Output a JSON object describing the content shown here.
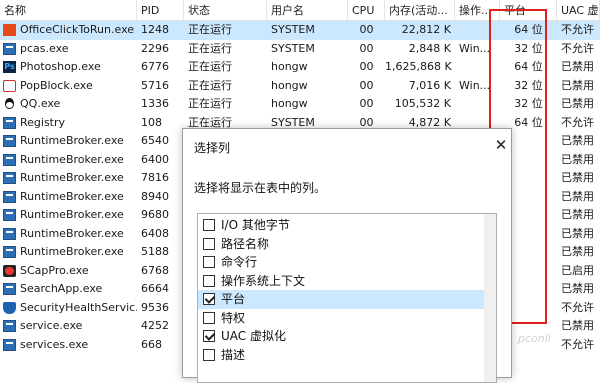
{
  "columns": [
    "名称",
    "PID",
    "状态",
    "用户名",
    "CPU",
    "内存(活动...",
    "操作...",
    "平台",
    "UAC 虚拟化"
  ],
  "rows": [
    {
      "name": "OfficeClickToRun.exe",
      "pid": "1248",
      "status": "正在运行",
      "user": "SYSTEM",
      "cpu": "00",
      "mem": "22,812 K",
      "op": "",
      "platform": "64 位",
      "uac": "不允许",
      "icon": "office-icon",
      "selected": true
    },
    {
      "name": "pcas.exe",
      "pid": "2296",
      "status": "正在运行",
      "user": "SYSTEM",
      "cpu": "00",
      "mem": "2,848 K",
      "op": "Win...",
      "platform": "32 位",
      "uac": "不允许",
      "icon": "app-icon",
      "selected": false
    },
    {
      "name": "Photoshop.exe",
      "pid": "6776",
      "status": "正在运行",
      "user": "hongw",
      "cpu": "00",
      "mem": "1,625,868 K",
      "op": "",
      "platform": "64 位",
      "uac": "已禁用",
      "icon": "photoshop-icon",
      "selected": false
    },
    {
      "name": "PopBlock.exe",
      "pid": "5716",
      "status": "正在运行",
      "user": "hongw",
      "cpu": "00",
      "mem": "7,016 K",
      "op": "Win...",
      "platform": "32 位",
      "uac": "已禁用",
      "icon": "popblock-icon",
      "selected": false
    },
    {
      "name": "QQ.exe",
      "pid": "1336",
      "status": "正在运行",
      "user": "hongw",
      "cpu": "00",
      "mem": "105,532 K",
      "op": "",
      "platform": "32 位",
      "uac": "已禁用",
      "icon": "qq-icon",
      "selected": false
    },
    {
      "name": "Registry",
      "pid": "108",
      "status": "正在运行",
      "user": "SYSTEM",
      "cpu": "00",
      "mem": "4,872 K",
      "op": "",
      "platform": "64 位",
      "uac": "不允许",
      "icon": "app-icon",
      "selected": false
    },
    {
      "name": "RuntimeBroker.exe",
      "pid": "6540",
      "status": "",
      "user": "",
      "cpu": "",
      "mem": "",
      "op": "",
      "platform": "",
      "uac": "已禁用",
      "icon": "app-icon",
      "selected": false
    },
    {
      "name": "RuntimeBroker.exe",
      "pid": "6400",
      "status": "",
      "user": "",
      "cpu": "",
      "mem": "",
      "op": "",
      "platform": "",
      "uac": "已禁用",
      "icon": "app-icon",
      "selected": false
    },
    {
      "name": "RuntimeBroker.exe",
      "pid": "7816",
      "status": "",
      "user": "",
      "cpu": "",
      "mem": "",
      "op": "",
      "platform": "",
      "uac": "已禁用",
      "icon": "app-icon",
      "selected": false
    },
    {
      "name": "RuntimeBroker.exe",
      "pid": "8940",
      "status": "",
      "user": "",
      "cpu": "",
      "mem": "",
      "op": "",
      "platform": "",
      "uac": "已禁用",
      "icon": "app-icon",
      "selected": false
    },
    {
      "name": "RuntimeBroker.exe",
      "pid": "9680",
      "status": "",
      "user": "",
      "cpu": "",
      "mem": "",
      "op": "",
      "platform": "",
      "uac": "已禁用",
      "icon": "app-icon",
      "selected": false
    },
    {
      "name": "RuntimeBroker.exe",
      "pid": "6408",
      "status": "",
      "user": "",
      "cpu": "",
      "mem": "",
      "op": "",
      "platform": "",
      "uac": "已禁用",
      "icon": "app-icon",
      "selected": false
    },
    {
      "name": "RuntimeBroker.exe",
      "pid": "5188",
      "status": "",
      "user": "",
      "cpu": "",
      "mem": "",
      "op": "",
      "platform": "",
      "uac": "已禁用",
      "icon": "app-icon",
      "selected": false
    },
    {
      "name": "SCapPro.exe",
      "pid": "6768",
      "status": "",
      "user": "",
      "cpu": "",
      "mem": "",
      "op": "",
      "platform": "",
      "uac": "已启用",
      "icon": "scappro-icon",
      "selected": false
    },
    {
      "name": "SearchApp.exe",
      "pid": "6664",
      "status": "",
      "user": "",
      "cpu": "",
      "mem": "",
      "op": "",
      "platform": "",
      "uac": "已禁用",
      "icon": "app-icon",
      "selected": false
    },
    {
      "name": "SecurityHealthServic...",
      "pid": "9536",
      "status": "",
      "user": "",
      "cpu": "",
      "mem": "",
      "op": "",
      "platform": "",
      "uac": "不允许",
      "icon": "shield-icon",
      "selected": false
    },
    {
      "name": "service.exe",
      "pid": "4252",
      "status": "",
      "user": "",
      "cpu": "",
      "mem": "",
      "op": "",
      "platform": "",
      "uac": "已禁用",
      "icon": "app-icon",
      "selected": false
    },
    {
      "name": "services.exe",
      "pid": "668",
      "status": "",
      "user": "",
      "cpu": "",
      "mem": "",
      "op": "",
      "platform": "",
      "uac": "不允许",
      "icon": "app-icon",
      "selected": false
    }
  ],
  "dialog": {
    "title": "选择列",
    "description": "选择将显示在表中的列。",
    "close_glyph": "✕",
    "options": [
      {
        "label": "I/O 其他字节",
        "checked": false,
        "highlighted": false
      },
      {
        "label": "路径名称",
        "checked": false,
        "highlighted": false
      },
      {
        "label": "命令行",
        "checked": false,
        "highlighted": false
      },
      {
        "label": "操作系统上下文",
        "checked": false,
        "highlighted": false
      },
      {
        "label": "平台",
        "checked": true,
        "highlighted": true
      },
      {
        "label": "特权",
        "checked": false,
        "highlighted": false
      },
      {
        "label": "UAC 虚拟化",
        "checked": true,
        "highlighted": false
      },
      {
        "label": "描述",
        "checked": false,
        "highlighted": false
      }
    ]
  },
  "highlight_color": "#e0201b",
  "watermark": "pconli"
}
